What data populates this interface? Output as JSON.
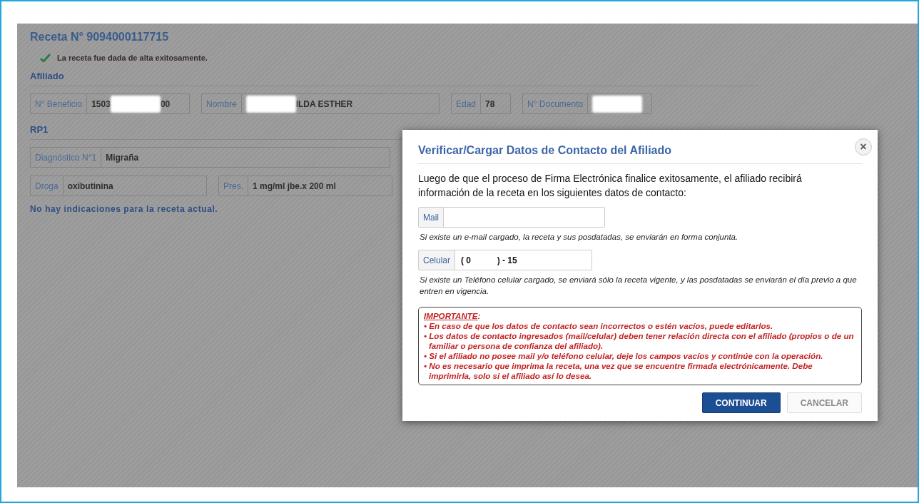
{
  "receta": {
    "title": "Receta N° 9094000117715",
    "success_message": "La receta fue dada de alta exitosamente."
  },
  "afiliado": {
    "heading": "Afiliado",
    "fields": [
      {
        "label": "N° Beneficio",
        "parts": [
          {
            "kind": "text",
            "text": "1503"
          },
          {
            "kind": "redacted"
          },
          {
            "kind": "text",
            "text": "00"
          }
        ]
      },
      {
        "label": "Nombre",
        "parts": [
          {
            "kind": "redacted"
          },
          {
            "kind": "text",
            "text": "ILDA ESTHER"
          }
        ]
      },
      {
        "label": "Edad",
        "parts": [
          {
            "kind": "text",
            "text": "78"
          }
        ]
      },
      {
        "label": "N° Documento",
        "parts": [
          {
            "kind": "redacted"
          }
        ]
      }
    ]
  },
  "rp1": {
    "heading": "RP1",
    "diagnosis": {
      "label": "Diagnóstico N°1",
      "value": "Migraña"
    },
    "drug_fields": [
      {
        "label": "Droga",
        "value": "oxibutinina"
      },
      {
        "label": "Pres.",
        "value": "1 mg/ml jbe.x 200 ml"
      }
    ],
    "no_indications": "No hay indicaciones para la receta actual."
  },
  "modal": {
    "title": "Verificar/Cargar Datos de Contacto del Afiliado",
    "close": "×",
    "intro": "Luego de que el proceso de Firma Electrónica finalice exitosamente, el afiliado recibirá información de la receta en los siguientes datos de contacto:",
    "mail": {
      "label": "Mail",
      "hint": "Si existe un e-mail cargado, la receta y sus posdatadas, se enviarán en forma conjunta."
    },
    "celular": {
      "label": "Celular",
      "value": "( 0           ) - 15",
      "hint": "Si existe un Teléfono celular cargado, se enviará sólo la receta vigente, y las posdatadas se enviarán el día previo a que entren en vigencia."
    },
    "important": {
      "title": "IMPORTANTE",
      "suffix": ":",
      "items": [
        "• En caso de que los datos de contacto sean incorrectos o estén vacíos, puede editarlos.",
        "• Los datos de contacto ingresados (mail/celular) deben tener relación directa con el afiliado (propios o de un familiar o persona de confianza del afiliado).",
        "• Si el afiliado no posee mail y/o teléfono celular, deje los campos vacíos y continúe con la operación.",
        "• No es necesario que imprima la receta, una vez que se encuentre firmada electrónicamente. Debe imprimirla, solo si el afiliado así lo desea."
      ]
    },
    "buttons": [
      {
        "label": "CONTINUAR",
        "kind": "primary"
      },
      {
        "label": "CANCELAR",
        "kind": "secondary"
      }
    ]
  }
}
